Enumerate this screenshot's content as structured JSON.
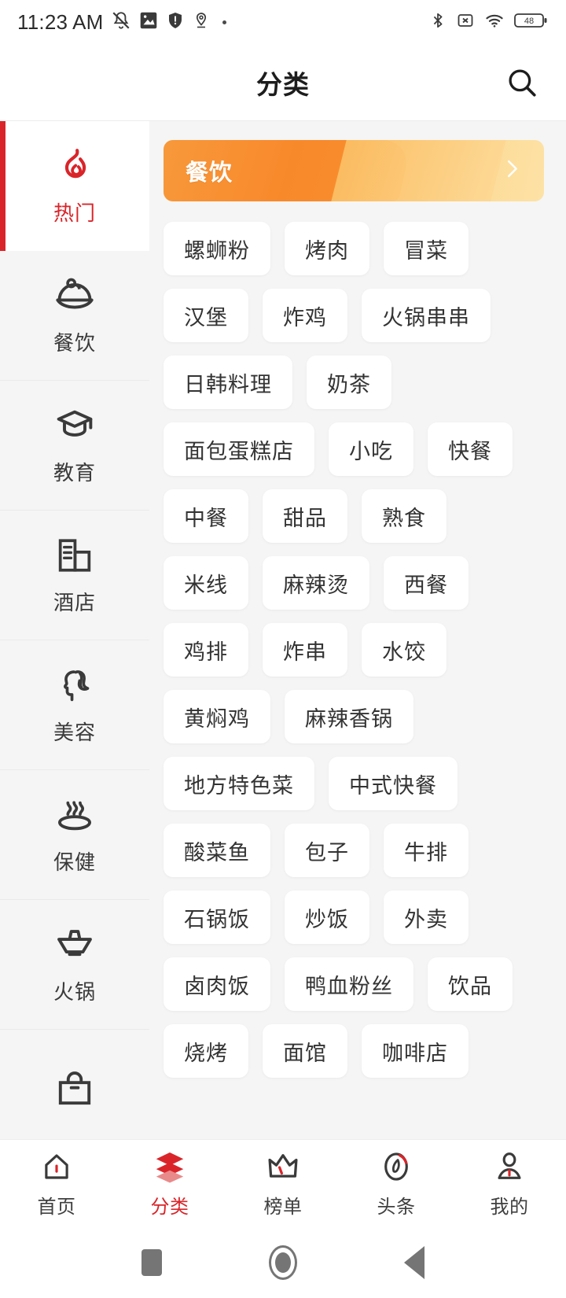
{
  "statusbar": {
    "time": "11:23 AM",
    "battery": "48",
    "left_icons": [
      "mute-bell-icon",
      "photo-sync-icon",
      "shield-icon",
      "location-pin-icon",
      "more-dot-icon"
    ],
    "right_icons": [
      "bluetooth-icon",
      "sim-off-icon",
      "wifi-icon",
      "battery-icon"
    ]
  },
  "header": {
    "title": "分类",
    "search_icon": "search-icon"
  },
  "sidebar": {
    "items": [
      {
        "label": "热门",
        "icon": "flame-icon",
        "active": true
      },
      {
        "label": "餐饮",
        "icon": "food-cloche-icon",
        "active": false
      },
      {
        "label": "教育",
        "icon": "graduation-cap-icon",
        "active": false
      },
      {
        "label": "酒店",
        "icon": "hotel-building-icon",
        "active": false
      },
      {
        "label": "美容",
        "icon": "beauty-face-icon",
        "active": false
      },
      {
        "label": "保健",
        "icon": "hot-spring-icon",
        "active": false
      },
      {
        "label": "火锅",
        "icon": "hotpot-icon",
        "active": false
      },
      {
        "label": "",
        "icon": "shopping-bag-icon",
        "active": false
      }
    ]
  },
  "main": {
    "banner": {
      "title": "餐饮",
      "arrow_icon": "chevron-right-icon",
      "color_start": "#f8892b",
      "color_end": "#fde2a6"
    },
    "tags": [
      "螺蛳粉",
      "烤肉",
      "冒菜",
      "汉堡",
      "炸鸡",
      "火锅串串",
      "日韩料理",
      "奶茶",
      "面包蛋糕店",
      "小吃",
      "快餐",
      "中餐",
      "甜品",
      "熟食",
      "米线",
      "麻辣烫",
      "西餐",
      "鸡排",
      "炸串",
      "水饺",
      "黄焖鸡",
      "麻辣香锅",
      "地方特色菜",
      "中式快餐",
      "酸菜鱼",
      "包子",
      "牛排",
      "石锅饭",
      "炒饭",
      "外卖",
      "卤肉饭",
      "鸭血粉丝",
      "饮品",
      "烧烤",
      "面馆",
      "咖啡店"
    ]
  },
  "tabbar": {
    "accent": "#d9252a",
    "items": [
      {
        "label": "首页",
        "icon": "home-icon",
        "active": false
      },
      {
        "label": "分类",
        "icon": "category-layers-icon",
        "active": true
      },
      {
        "label": "榜单",
        "icon": "crown-icon",
        "active": false
      },
      {
        "label": "头条",
        "icon": "compass-icon",
        "active": false
      },
      {
        "label": "我的",
        "icon": "person-icon",
        "active": false
      }
    ]
  },
  "androidnav": {
    "buttons": [
      "recents-square-icon",
      "home-circle-icon",
      "back-triangle-icon"
    ]
  }
}
